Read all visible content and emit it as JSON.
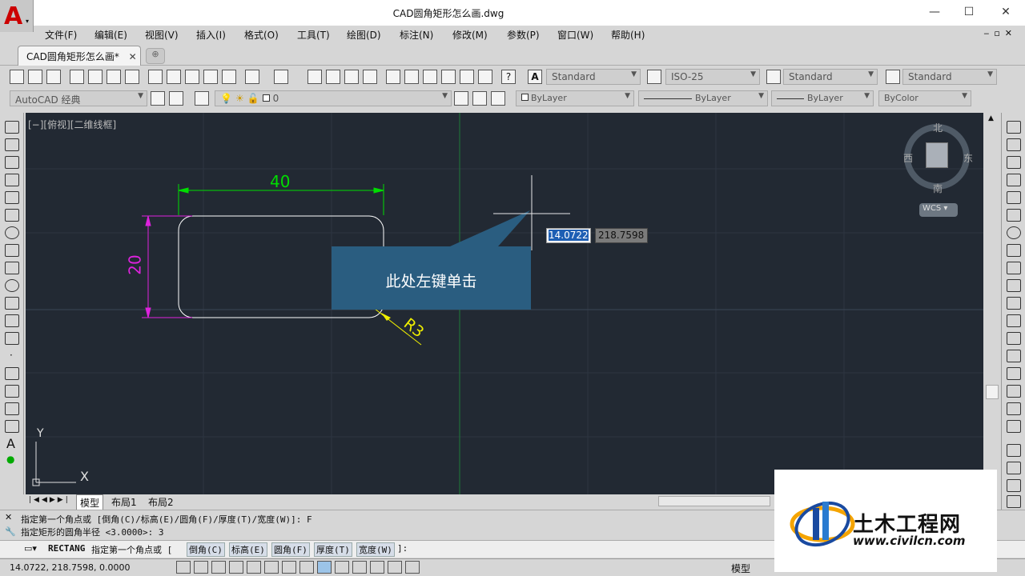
{
  "window": {
    "title": "CAD圆角矩形怎么画.dwg",
    "minimize": "—",
    "maximize": "☐",
    "close": "✕"
  },
  "menu": [
    "文件(F)",
    "编辑(E)",
    "视图(V)",
    "插入(I)",
    "格式(O)",
    "工具(T)",
    "绘图(D)",
    "标注(N)",
    "修改(M)",
    "参数(P)",
    "窗口(W)",
    "帮助(H)"
  ],
  "tabs": {
    "active": "CAD圆角矩形怎么画*",
    "close": "✕"
  },
  "toolbar": {
    "text_style": "Standard",
    "dim_style": "ISO-25",
    "table_style": "Standard",
    "mleader_style": "Standard"
  },
  "toolbar2": {
    "workspace": "AutoCAD 经典",
    "layer": "0",
    "color": "ByLayer",
    "linetype": "ByLayer",
    "lineweight": "ByLayer",
    "plotstyle": "ByColor"
  },
  "viewport": {
    "label": "[−][俯视][二维线框]"
  },
  "viewcube": {
    "north": "北",
    "south": "南",
    "east": "东",
    "west": "西",
    "wcs": "WCS"
  },
  "drawing": {
    "dim_width": "40",
    "dim_height": "20",
    "radius_label": "R3",
    "callout": "此处左键单击",
    "input_x": "14.0722",
    "input_y": "218.7598",
    "ucs_y": "Y",
    "ucs_x": "X"
  },
  "layout_tabs": [
    "模型",
    "布局1",
    "布局2"
  ],
  "command": {
    "history": [
      "指定第一个角点或 [倒角(C)/标高(E)/圆角(F)/厚度(T)/宽度(W)]: F",
      "指定矩形的圆角半径 <3.0000>: 3"
    ],
    "prompt_name": "RECTANG",
    "prompt_text": "指定第一个角点或 [",
    "options": [
      "倒角(C)",
      "标高(E)",
      "圆角(F)",
      "厚度(T)",
      "宽度(W)"
    ],
    "prompt_end": "]:"
  },
  "status": {
    "coords": "14.0722, 218.7598, 0.0000",
    "model": "模型"
  },
  "watermark": {
    "name": "土木工程网",
    "url": "www.civilcn.com"
  },
  "colors": {
    "canvas": "#222933",
    "dimension": "#00dd00",
    "dimension_v": "#dd22dd",
    "callout": "#2a5d80",
    "radius": "#eeee00"
  }
}
